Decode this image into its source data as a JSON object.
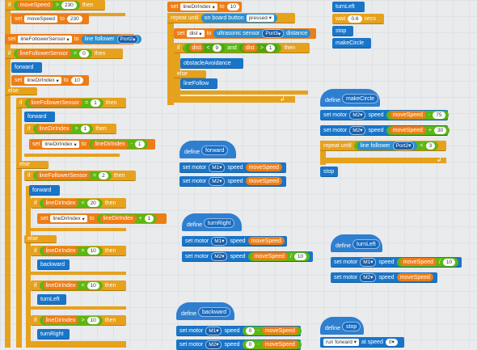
{
  "left": {
    "if1": {
      "kw": "if",
      "var": "moveSpeed",
      "op": ">",
      "num": "230",
      "then": "then"
    },
    "set1": {
      "kw": "set",
      "var": "moveSpeed",
      "to": "to",
      "val": "230"
    },
    "set2": {
      "kw": "set",
      "var": "lineFollowerSensor",
      "to": "to",
      "sensor": "line follower",
      "port": "Port2"
    },
    "if2": {
      "kw": "if",
      "var": "lineFollowerSensor",
      "op": "=",
      "num": "0",
      "then": "then"
    },
    "forward1": "forward",
    "set3": {
      "kw": "set",
      "var": "lineDirIndex",
      "to": "to",
      "val": "10"
    },
    "else1": "else",
    "if3": {
      "kw": "if",
      "var": "lineFollowerSensor",
      "op": "=",
      "num": "1",
      "then": "then"
    },
    "forward2": "forward",
    "if4": {
      "kw": "if",
      "var": "lineDirIndex",
      "op": ">",
      "num": "1",
      "then": "then"
    },
    "set4": {
      "kw": "set",
      "var": "lineDirIndex",
      "to": "to",
      "var2": "lineDirIndex",
      "op": "-",
      "num": "1"
    },
    "else2": "else",
    "if5": {
      "kw": "if",
      "var": "lineFollowerSensor",
      "op": "=",
      "num": "2",
      "then": "then"
    },
    "forward3": "forward",
    "if6": {
      "kw": "if",
      "var": "lineDirIndex",
      "op": "<",
      "num": "20",
      "then": "then"
    },
    "set5": {
      "kw": "set",
      "var": "lineDirIndex",
      "to": "to",
      "var2": "lineDirIndex",
      "op": "+",
      "num": "1"
    },
    "else3": "else",
    "if7": {
      "kw": "if",
      "var": "lineDirIndex",
      "op": "=",
      "num": "10",
      "then": "then"
    },
    "backward": "backward",
    "if8": {
      "kw": "if",
      "var": "lineDirIndex",
      "op": "<",
      "num": "10",
      "then": "then"
    },
    "turnLeft": "turnLeft",
    "if9": {
      "kw": "if",
      "var": "lineDirIndex",
      "op": ">",
      "num": "10",
      "then": "then"
    },
    "turnRight": "turnRight"
  },
  "middle": {
    "set1": {
      "kw": "set",
      "var": "lineDirIndex",
      "to": "to",
      "val": "10"
    },
    "repeat": {
      "kw": "repeat until",
      "cond": "on board button",
      "state": "pressed"
    },
    "set2": {
      "kw": "set",
      "var": "dist",
      "to": "to",
      "sensor": "ultrasonic sensor",
      "port": "Port3",
      "unit": "distance"
    },
    "if1": {
      "kw": "if",
      "var1": "dist",
      "op1": "<",
      "num1": "9",
      "and": "and",
      "var2": "dist",
      "op2": ">",
      "num2": "1",
      "then": "then"
    },
    "call1": "obstacleAvoidance",
    "else": "else",
    "call2": "lineFollow"
  },
  "right_top": {
    "turnLeft": "turnLeft",
    "wait": {
      "kw": "wait",
      "num": "0.6",
      "unit": "secs"
    },
    "stop": "stop",
    "makeCircle": "makeCircle"
  },
  "defines": {
    "forward": {
      "kw": "define",
      "name": "forward",
      "m1": {
        "set": "set motor",
        "motor": "M1",
        "speed": "speed",
        "var": "moveSpeed"
      },
      "m2": {
        "set": "set motor",
        "motor": "M2",
        "speed": "speed",
        "var": "moveSpeed"
      }
    },
    "turnRight": {
      "kw": "define",
      "name": "turnRight",
      "m1": {
        "set": "set motor",
        "motor": "M1",
        "speed": "speed",
        "var": "moveSpeed"
      },
      "m2": {
        "set": "set motor",
        "motor": "M2",
        "speed": "speed",
        "var": "moveSpeed",
        "op": "/",
        "num": "10"
      }
    },
    "backward": {
      "kw": "define",
      "name": "backward",
      "m1": {
        "set": "set motor",
        "motor": "M1",
        "speed": "speed",
        "num": "0",
        "op": "-",
        "var": "moveSpeed"
      },
      "m2": {
        "set": "set motor",
        "motor": "M2",
        "speed": "speed",
        "num": "0",
        "op": "-",
        "var": "moveSpeed"
      }
    },
    "makeCircle": {
      "kw": "define",
      "name": "makeCircle",
      "m2a": {
        "set": "set motor",
        "motor": "M2",
        "speed": "speed",
        "var": "moveSpeed",
        "op": "-",
        "num": "75"
      },
      "m2b": {
        "set": "set motor",
        "motor": "M2",
        "speed": "speed",
        "var": "moveSpeed",
        "op": "+",
        "num": "30"
      },
      "repeat": {
        "kw": "repeat until",
        "sensor": "line follower",
        "port": "Port2",
        "op": "<",
        "num": "3"
      },
      "stop": "stop"
    },
    "turnLeft": {
      "kw": "define",
      "name": "turnLeft",
      "m1": {
        "set": "set motor",
        "motor": "M1",
        "speed": "speed",
        "var": "moveSpeed",
        "op": "/",
        "num": "10"
      },
      "m2": {
        "set": "set motor",
        "motor": "M2",
        "speed": "speed",
        "var": "moveSpeed"
      }
    },
    "stop": {
      "kw": "define",
      "name": "stop",
      "run": {
        "kw": "run",
        "dir": "forward",
        "at": "at speed",
        "num": "0"
      }
    }
  }
}
